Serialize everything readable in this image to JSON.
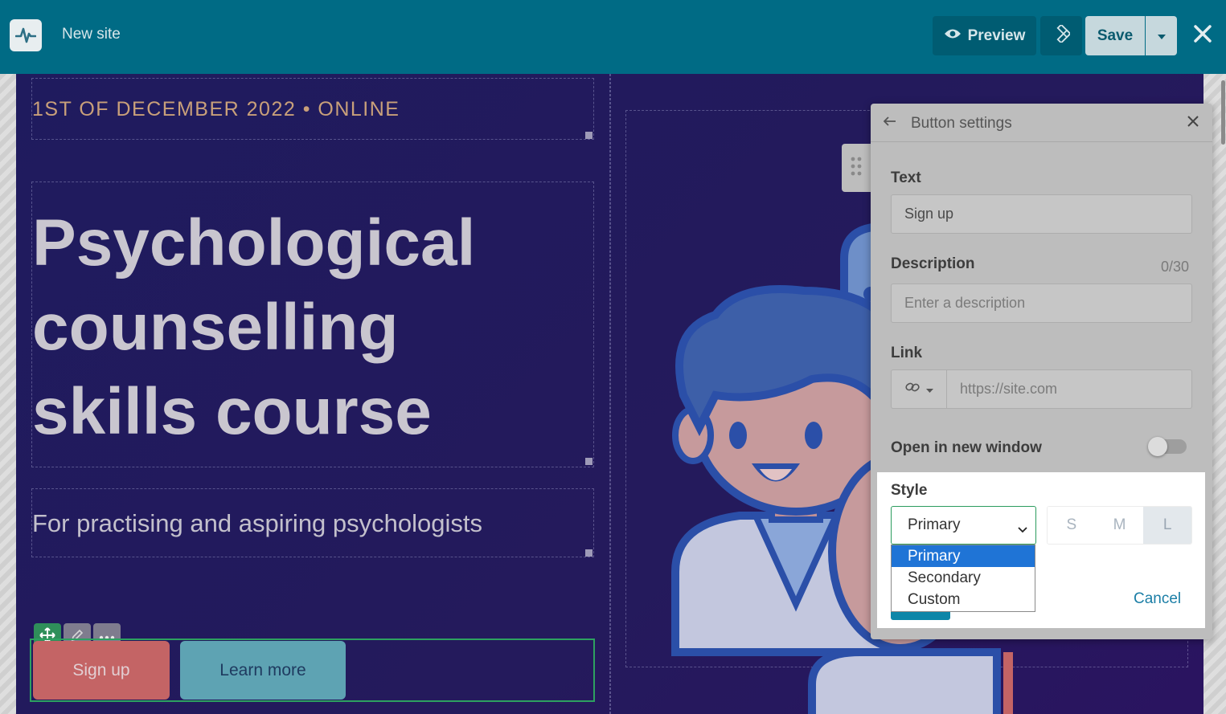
{
  "topbar": {
    "site_name": "New site",
    "preview_label": "Preview",
    "save_label": "Save"
  },
  "hero": {
    "date_line": "1ST OF DECEMBER 2022 • ONLINE",
    "title_lines": [
      "Psychological",
      "counselling",
      "skills course"
    ],
    "subtitle": "For practising and aspiring psychologists",
    "buttons": {
      "signup": "Sign up",
      "learn_more": "Learn more"
    }
  },
  "panel": {
    "title": "Button settings",
    "text_label": "Text",
    "text_value": "Sign up",
    "description_label": "Description",
    "description_counter": "0/30",
    "description_placeholder": "Enter a description",
    "link_label": "Link",
    "link_placeholder": "https://site.com",
    "new_window_label": "Open in new window",
    "new_window_on": false,
    "style_label": "Style",
    "style_selected": "Primary",
    "style_options": [
      "Primary",
      "Secondary",
      "Custom"
    ],
    "sizes": [
      "S",
      "M",
      "L"
    ],
    "size_selected": "L",
    "cancel_label": "Cancel"
  },
  "colors": {
    "topbar": "#006b85",
    "hero_bg": "#1f1b5e",
    "accent_green": "#2da160",
    "signup_button": "#c46465",
    "learn_button": "#5ea3b3",
    "dropdown_highlight": "#1f74d6"
  }
}
